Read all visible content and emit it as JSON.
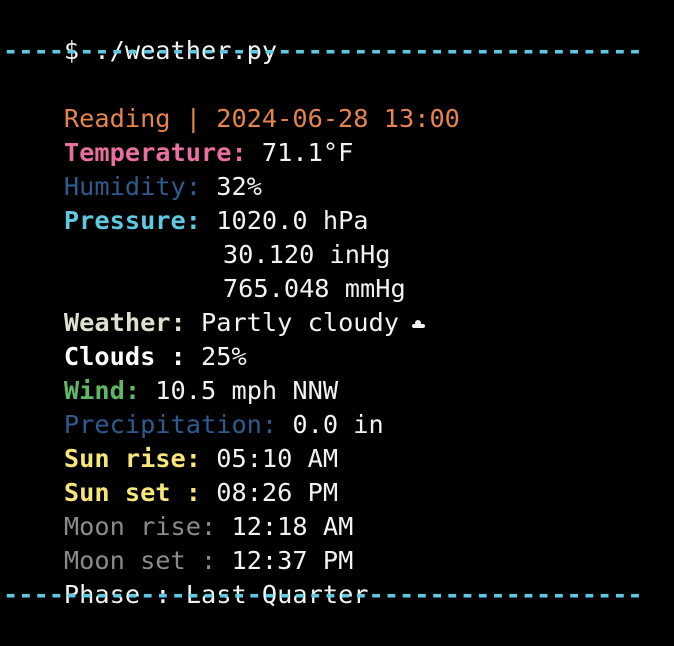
{
  "prompt": {
    "text": "$ ./weather.py"
  },
  "divider": "-------------------------------------------------------------------------",
  "colors": {
    "divider": "#5ec9e0",
    "reading": "#e5844e",
    "temperature": "#e86fa0",
    "humidity": "#2f5a8e",
    "pressure": "#5ec9e0",
    "weather": "#e0e0d0",
    "clouds": "#ffffff",
    "wind": "#5fb865",
    "precipitation": "#2f5a8e",
    "sun": "#f7e67a",
    "moon": "#8a8a8a",
    "value": "#f2f2f2"
  },
  "reading": {
    "text": "Reading | 2024-06-28 13:00"
  },
  "temperature": {
    "label": "Temperature:",
    "value": " 71.1°F"
  },
  "humidity": {
    "label": "Humidity:",
    "value": " 32%"
  },
  "pressure": {
    "label": "Pressure:",
    "value_hpa": " 1020.0 hPa",
    "value_inhg": "30.120 inHg",
    "value_mmhg": "765.048 mmHg"
  },
  "weather": {
    "label": "Weather:",
    "value": " Partly cloudy",
    "icon": "cloud-icon"
  },
  "clouds": {
    "label": "Clouds :",
    "value": " 25%"
  },
  "wind": {
    "label": "Wind:",
    "value": " 10.5 mph NNW"
  },
  "precipitation": {
    "label": "Precipitation:",
    "value": " 0.0 in"
  },
  "sun_rise": {
    "label": "Sun rise:",
    "value": " 05:10 AM"
  },
  "sun_set": {
    "label": "Sun set :",
    "value": " 08:26 PM"
  },
  "moon_rise": {
    "label": "Moon rise:",
    "value": " 12:18 AM"
  },
  "moon_set": {
    "label": "Moon set :",
    "value": " 12:37 PM"
  },
  "phase": {
    "label": "Phase :",
    "value": " Last Quarter"
  }
}
